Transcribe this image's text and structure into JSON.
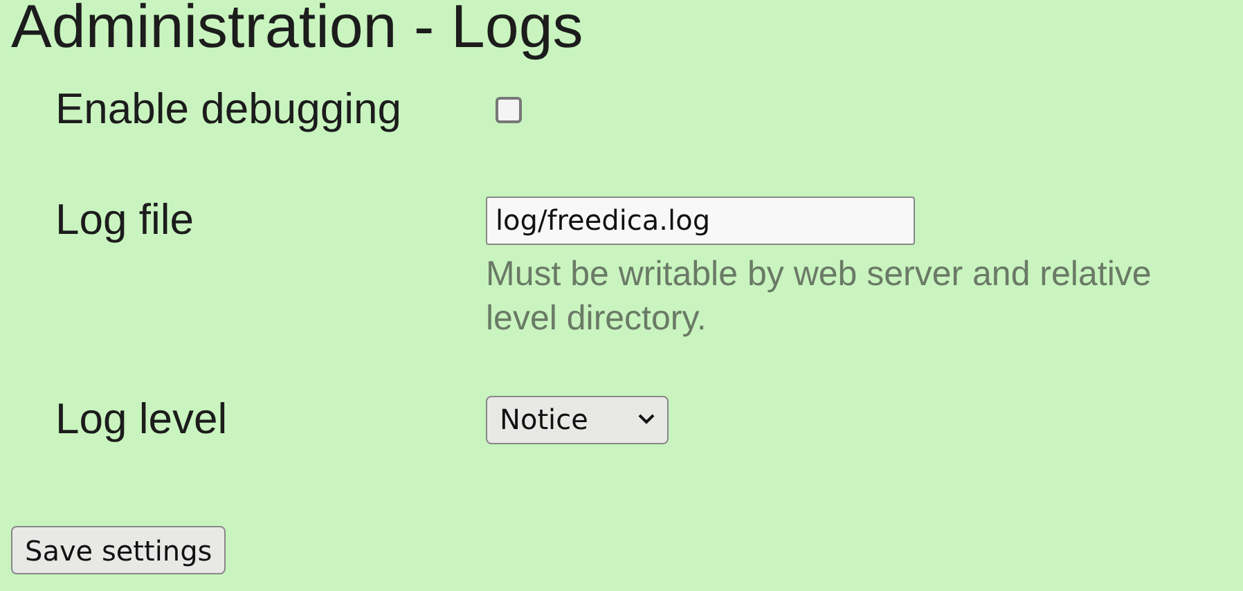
{
  "title": "Administration - Logs",
  "settings": [
    {
      "kind": "checkbox",
      "label": "Enable debugging",
      "checked": false
    },
    {
      "kind": "text",
      "label": "Log file",
      "value": "log/freedica.log",
      "hint_lines": [
        "Must be writable by web server and relative",
        "level directory."
      ]
    },
    {
      "kind": "select",
      "label": "Log level",
      "value": "Notice"
    }
  ],
  "save_button": "Save settings"
}
